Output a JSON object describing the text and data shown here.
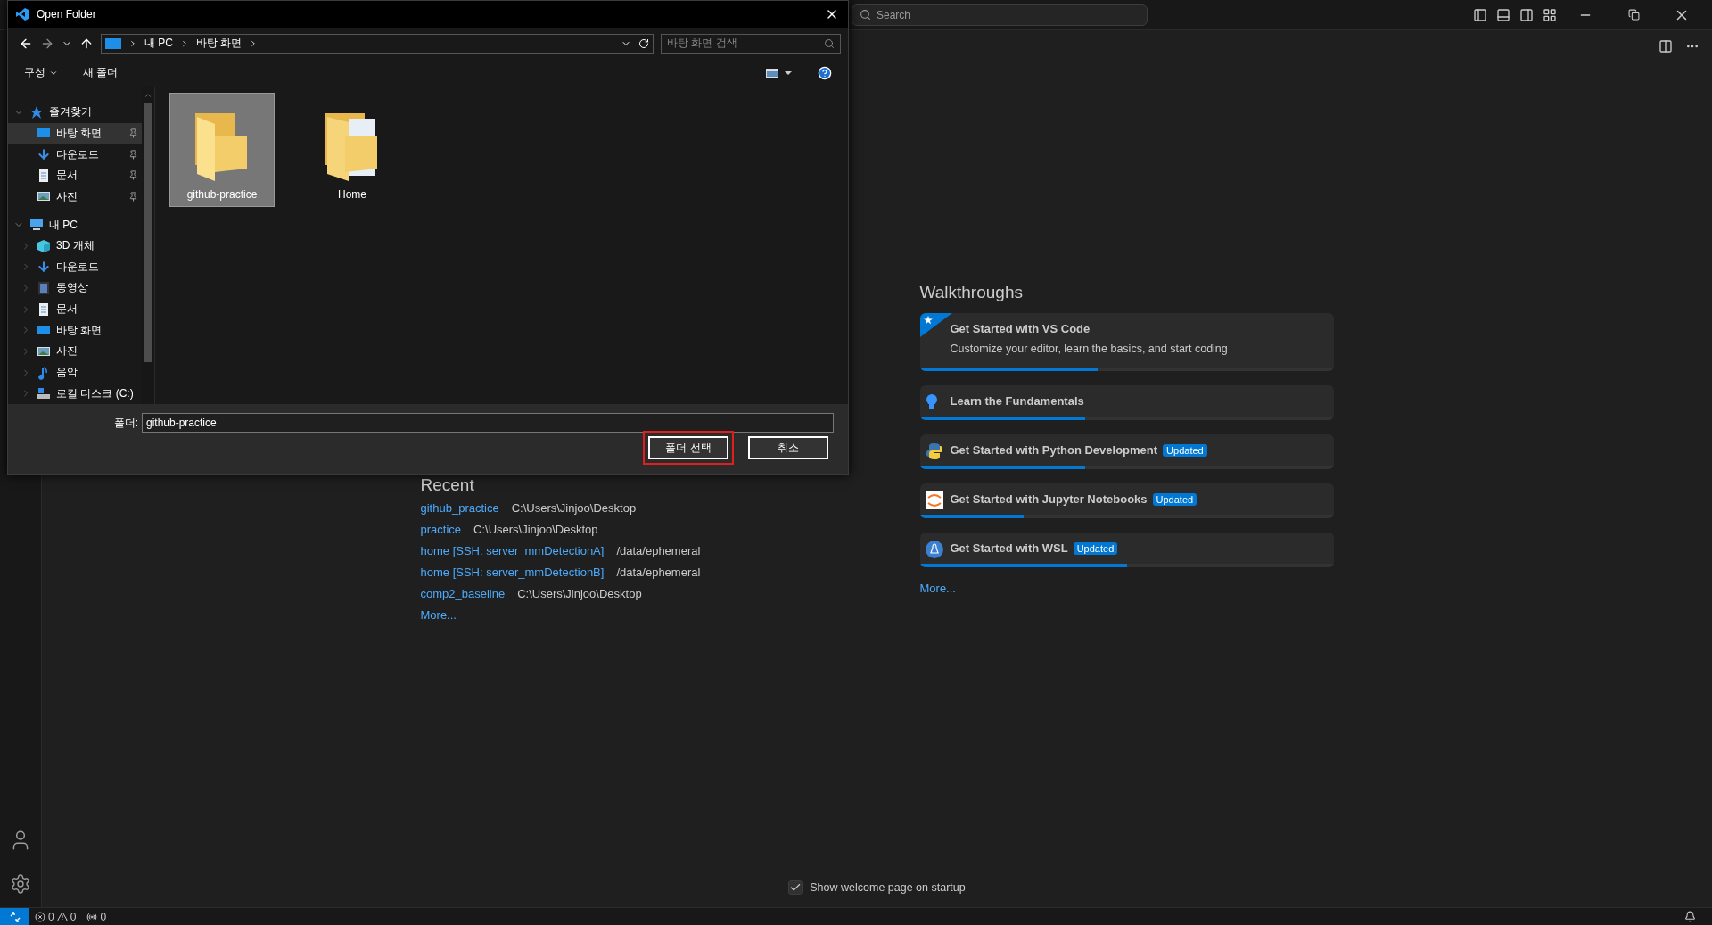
{
  "titlebar": {
    "search_placeholder": "Search"
  },
  "dialog": {
    "title": "Open Folder",
    "breadcrumb": [
      "내 PC",
      "바탕 화면"
    ],
    "search_placeholder": "바탕 화면 검색",
    "toolbar": [
      "구성",
      "새 폴더"
    ],
    "tree": [
      {
        "label": "즐겨찾기",
        "kind": "star",
        "expanded": true,
        "children": [
          {
            "label": "바탕 화면",
            "kind": "desktop",
            "selected": true,
            "pinned": true
          },
          {
            "label": "다운로드",
            "kind": "download",
            "selected": false,
            "pinned": true
          },
          {
            "label": "문서",
            "kind": "document",
            "selected": false,
            "pinned": true
          },
          {
            "label": "사진",
            "kind": "pictures",
            "selected": false,
            "pinned": true
          }
        ]
      },
      {
        "label": "내 PC",
        "kind": "pc",
        "expanded": true,
        "children": [
          {
            "label": "3D 개체",
            "kind": "cube",
            "selected": false,
            "expanded": false
          },
          {
            "label": "다운로드",
            "kind": "download",
            "selected": false,
            "expanded": false
          },
          {
            "label": "동영상",
            "kind": "video",
            "selected": false,
            "expanded": false
          },
          {
            "label": "문서",
            "kind": "document",
            "selected": false,
            "expanded": false
          },
          {
            "label": "바탕 화면",
            "kind": "desktop",
            "selected": false,
            "expanded": false
          },
          {
            "label": "사진",
            "kind": "pictures",
            "selected": false,
            "expanded": false
          },
          {
            "label": "음악",
            "kind": "music",
            "selected": false,
            "expanded": false
          },
          {
            "label": "로컬 디스크 (C:)",
            "kind": "disk",
            "selected": false,
            "expanded": false
          }
        ]
      }
    ],
    "files": [
      {
        "name": "github-practice",
        "kind": "empty",
        "selected": true
      },
      {
        "name": "Home",
        "kind": "full",
        "selected": false
      }
    ],
    "folder_label": "폴더:",
    "folder_value": "github-practice",
    "buttons": [
      {
        "label": "폴더 선택",
        "highlighted": true
      },
      {
        "label": "취소",
        "highlighted": false
      }
    ]
  },
  "recent": {
    "heading": "Recent",
    "items": [
      {
        "name": "github_practice",
        "path": "C:\\Users\\Jinjoo\\Desktop"
      },
      {
        "name": "practice",
        "path": "C:\\Users\\Jinjoo\\Desktop"
      },
      {
        "name": "home [SSH: server_mmDetectionA]",
        "path": "/data/ephemeral"
      },
      {
        "name": "home [SSH: server_mmDetectionB]",
        "path": "/data/ephemeral"
      },
      {
        "name": "comp2_baseline",
        "path": "C:\\Users\\Jinjoo\\Desktop"
      }
    ],
    "more": "More..."
  },
  "walkthroughs": {
    "heading": "Walkthroughs",
    "items": [
      {
        "kind": "star",
        "title": "Get Started with VS Code",
        "description": "Customize your editor, learn the basics, and start coding",
        "level": 0.43
      },
      {
        "kind": "bulb",
        "title": "Learn the Fundamentals",
        "level": 0.4
      },
      {
        "kind": "python",
        "title": "Get Started with Python Development",
        "badge": "Updated",
        "level": 0.4
      },
      {
        "kind": "jupyter",
        "title": "Get Started with Jupyter Notebooks",
        "badge": "Updated",
        "level": 0.25
      },
      {
        "kind": "linux",
        "title": "Get Started with WSL",
        "badge": "Updated",
        "level": 0.5
      }
    ],
    "more": "More..."
  },
  "startup": {
    "label": "Show welcome page on startup",
    "checked": true
  },
  "status_bar": {
    "errors": "0",
    "warnings": "0",
    "ports": "0"
  }
}
